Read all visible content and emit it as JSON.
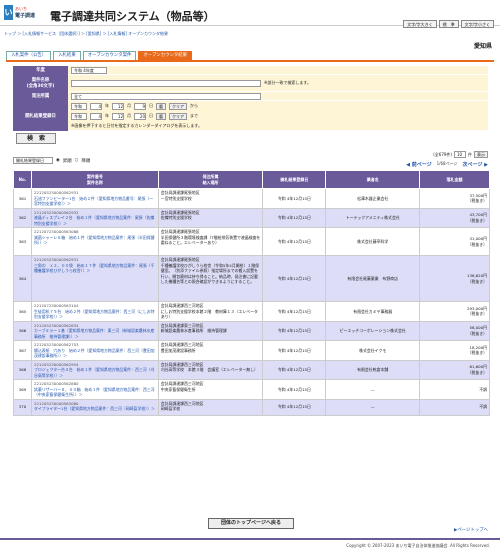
{
  "header": {
    "logo_mark": "い",
    "logo_text1": "あいち",
    "logo_text2": "電子調達",
    "title": "電子調達共同システム（物品等）",
    "font_large": "文字/字大きく",
    "standard": "標　準",
    "font_small": "文字/字小さく"
  },
  "breadcrumb": "トップ ＞ [入札情報サービス（団体選択）] ＞ [愛知県] ＞ [入札情報] オープンカウンタ結果",
  "prefecture": "愛知県",
  "tabs": [
    "入札案件（公告）",
    "入札結果",
    "オープンカウンタ案件",
    "オープンカウンタ結果"
  ],
  "form": {
    "year_label": "年度",
    "year_value": "令和 4年度",
    "case_label": "案件名称",
    "case_sub": "(全角30文字)",
    "case_note": "※部分一致で検索します。",
    "dept_label": "発注所属",
    "dept_value": "全て",
    "date_label": "開札結果登録日",
    "from": {
      "era": "令和",
      "y": "4",
      "y_u": "年",
      "m": "12",
      "m_u": "月",
      "d": "9",
      "d_u": "日",
      "cal": "曆",
      "clear": "クリア",
      "suffix": "から"
    },
    "to": {
      "era": "令和",
      "y": "4",
      "y_u": "年",
      "m": "12",
      "m_u": "月",
      "d": "20",
      "d_u": "日",
      "cal": "曆",
      "clear": "クリア",
      "suffix": "まで"
    },
    "date_note": "※画像を押下すると日付を指定するカレンダーダイアログを表示します。"
  },
  "search_button": "検　索",
  "sort": {
    "value": "開札結果登録日",
    "asc": "昇順",
    "desc": "降順"
  },
  "count": {
    "text": "(全679件)",
    "per_page": "10",
    "unit": "件",
    "display": "表示"
  },
  "pager": {
    "prev": "前ページ",
    "page": "1/68ページ",
    "next": "次ページ"
  },
  "table": {
    "headers": [
      "No.",
      "案件番号\n案件名称",
      "発注所属\n納入場所",
      "開札結果登録日",
      "業者名",
      "落札金額"
    ],
    "rows": [
      {
        "no": "361",
        "id": "221205230000562931",
        "name": "石油ファンヒーター1台　始め２件（愛知県地方物品番号：尾張（一宮特別支援学校））＞",
        "dept": "会計局調達課尾張地区\n一宮特別支援学校",
        "date": "令和 4年12月15日",
        "vendor": "松澤木器企業会社",
        "amount": "37,500円\n（税抜き）"
      },
      {
        "no": "362",
        "id": "221205230000562932",
        "name": "液晶ディスプレイ２台　始め１件（愛知県地方物品案件：尾張（佐織特別支援学校））＞",
        "dept": "会計局調達課尾張地区\n佐織特別支援学校",
        "date": "令和 4年12月15日",
        "vendor": "トーテックアメニティ株式会社",
        "amount": "43,700円\n（税抜き）"
      },
      {
        "no": "363",
        "id": "221207230000563066",
        "name": "滅菌シャーレ６箱　始め１件（愛知県地方物品案件：尾張（半田保健所））＞",
        "dept": "会計局調達課尾張地区\n半田保健所３階環境検査課（T階給排気装置で液晶検査を委ねること。エレベーターあり）",
        "date": "令和 4年12月15日",
        "vendor": "株式会社藤亭科学",
        "amount": "31,000円\n（税抜き）"
      },
      {
        "no": "364",
        "id": "221205230000562931",
        "name": "三角巾　ｘ２、００袋　始め１７件（愛知県地方物品案件：尾張（千種養護学校ひがしうら校舎））＞",
        "dept": "会計局調達課尾張地区\n千種養護学校ひがしうら校舎（令和5年4月開校）１階保健室。（別添ファイル参照）指定場所までの搬入設置を行い、開包廃材は持ち帰ること。納品時、発注書に記載した機種名等との照合確認ができるようにすること。",
        "date": "令和 4年12月15日",
        "vendor": "有限会社尾藤薬業　布野商店",
        "amount": "136,620円\n（税抜き）"
      },
      {
        "no": "365",
        "id": "221207230000563104",
        "name": "生徒用机７５台　始め２件（愛知県地方物品案件：西三河（にしお特別支援学校））＞",
        "dept": "会計局調達課西三河地区\nにしお特別支援学校本館２階　教材庫１３（エレベータあり）",
        "date": "令和 4年12月15日",
        "vendor": "有限会社カミヤ事務器",
        "amount": "293,000円\n（税抜き）"
      },
      {
        "no": "366",
        "id": "221205230000562634",
        "name": "カーブミラー１基（愛知県地方物品案件：東三河（新城設楽農林水産事務所　維持管理課））＞",
        "dept": "会計局調達課東三河地区\n新城設楽農林水産事務所　維持管理課",
        "date": "令和 4年12月15日",
        "vendor": "ピーエッチコーポレーション株式会社",
        "amount": "58,000円\n（税抜き）"
      },
      {
        "no": "367",
        "id": "221205230000562753",
        "name": "綴込表紙　穴あり　始め２件（愛知県地方物品案件：西三河（豊田加茂建設事務所））＞",
        "dept": "会計局調達課西三河地区\n豊田加茂建設事務所",
        "date": "令和 4年12月15日",
        "vendor": "株式会社イクモ",
        "amount": "18,200円\n（税抜き）"
      },
      {
        "no": "368",
        "id": "221205230000562954",
        "name": "プロジェクター台４台　始め１件（愛知県地方物品案件：西三河（刈谷高等学校））＞",
        "dept": "会計局調達課西三河地区\n刈谷高等学校　本館３階　会議室（エレベーター無し）",
        "date": "令和 4年12月15日",
        "vendor": "有限会社乾倉本舗",
        "amount": "61,600円\n（税抜き）"
      },
      {
        "no": "369",
        "id": "221205230000562880",
        "name": "試薬リザーバー８、００箱　始め１件（愛知県地方物品案件：西三河（中央家畜保健衛生所））＞",
        "dept": "会計局調達課西三河地区\n中央家畜保健衛生所",
        "date": "令和 4年12月15日",
        "vendor": "—",
        "amount": "不調"
      },
      {
        "no": "370",
        "id": "221205230000563080",
        "name": "タイプライター1台（愛知県地方物品案件：西三河（岡崎盲学校））＞",
        "dept": "会計局調達課西三河地区\n岡崎盲学校",
        "date": "令和 4年12月15日",
        "vendor": "—",
        "amount": "不調"
      }
    ]
  },
  "back_button": "団体のトップページへ戻る",
  "page_top": "ページトップへ",
  "footer": "Copyright © 2007-2023 あいち電子自治体推進協議会. All Rights Reserved."
}
